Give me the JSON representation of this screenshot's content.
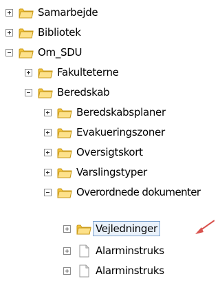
{
  "tree": {
    "items": [
      {
        "label": "Samarbejde",
        "icon": "folder-icon",
        "state": "collapsed"
      },
      {
        "label": "Bibliotek",
        "icon": "folder-icon",
        "state": "collapsed"
      },
      {
        "label": "Om_SDU",
        "icon": "folder-icon",
        "state": "expanded"
      },
      {
        "label": "Fakulteterne",
        "icon": "folder-icon",
        "state": "collapsed"
      },
      {
        "label": "Beredskab",
        "icon": "folder-icon",
        "state": "expanded"
      },
      {
        "label": "Beredskabsplaner",
        "icon": "folder-icon",
        "state": "collapsed"
      },
      {
        "label": "Evakueringszoner",
        "icon": "folder-icon",
        "state": "collapsed"
      },
      {
        "label": "Oversigtskort",
        "icon": "folder-icon",
        "state": "collapsed"
      },
      {
        "label": "Varslingstyper",
        "icon": "folder-icon",
        "state": "collapsed"
      },
      {
        "label": "Overordnede dokumenter",
        "icon": "folder-icon",
        "state": "expanded"
      },
      {
        "label": "Vejledninger",
        "icon": "folder-icon",
        "state": "collapsed",
        "selected": true
      },
      {
        "label": "Alarminstruks",
        "icon": "document-icon",
        "state": "collapsed"
      },
      {
        "label": "Alarminstruks",
        "icon": "document-icon",
        "state": "collapsed"
      }
    ]
  },
  "colors": {
    "folder": "#f3c33a",
    "selection_border": "#7da2ce",
    "arrow": "#d9534f"
  }
}
